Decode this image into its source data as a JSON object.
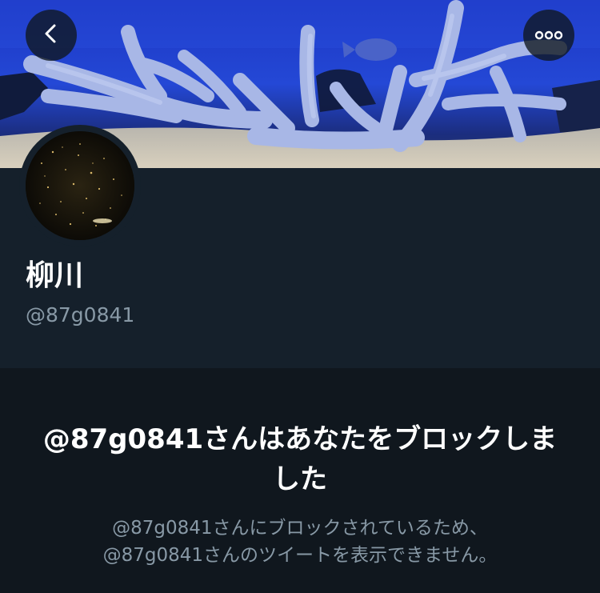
{
  "header": {
    "back_icon": "chevron-left-icon",
    "more_icon": "more-horizontal-icon",
    "banner_description": "",
    "avatar_description": ""
  },
  "profile": {
    "display_name": "柳川",
    "handle": "@87g0841"
  },
  "blocked": {
    "title": "@87g0841さんはあなたをブロックしました",
    "message_line1": "@87g0841さんにブロックされているため、",
    "message_line2": "@87g0841さんのツイートを表示できません。"
  },
  "colors": {
    "background": "#15202b",
    "blocked_background": "#10171e",
    "text_primary": "#ffffff",
    "text_secondary": "#8899a6"
  }
}
